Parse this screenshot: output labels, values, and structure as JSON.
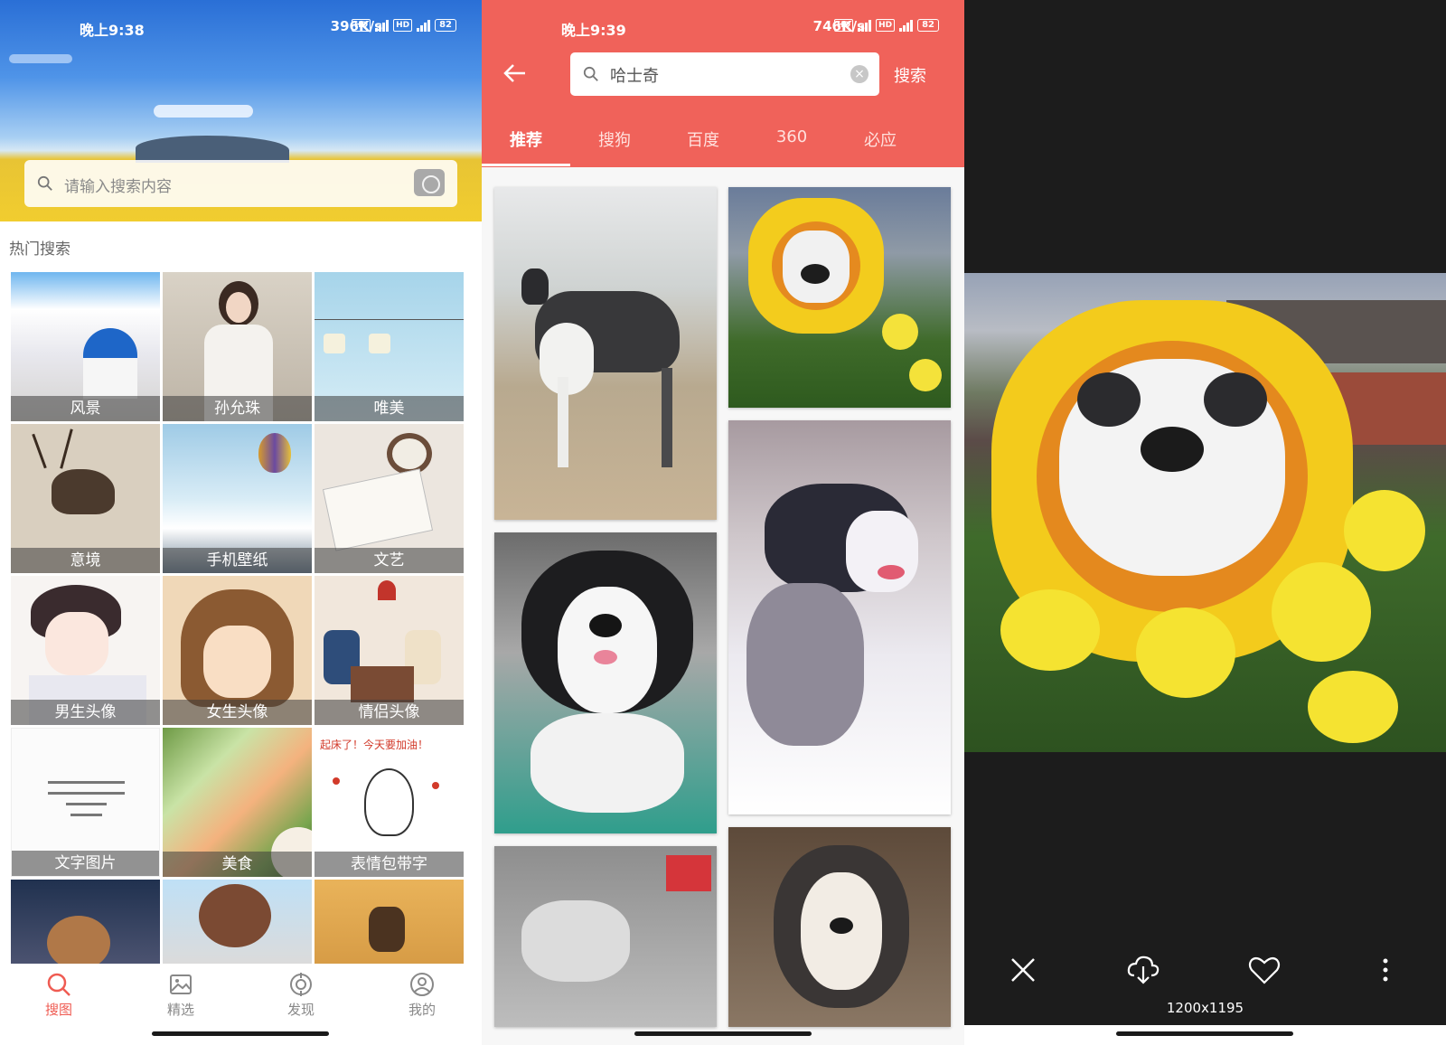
{
  "screen1": {
    "status": {
      "time": "晚上9:38",
      "net": "396K/s",
      "battery": "82"
    },
    "search": {
      "placeholder": "请输入搜索内容"
    },
    "hot_title": "热门搜索",
    "tiles": [
      {
        "label": "风景"
      },
      {
        "label": "孙允珠"
      },
      {
        "label": "唯美"
      },
      {
        "label": "意境"
      },
      {
        "label": "手机壁纸"
      },
      {
        "label": "文艺"
      },
      {
        "label": "男生头像"
      },
      {
        "label": "女生头像"
      },
      {
        "label": "情侣头像"
      },
      {
        "label": "文字图片"
      },
      {
        "label": "美食"
      },
      {
        "label": "表情包带字"
      }
    ],
    "sticker_text": "起床了！今天要加油！",
    "nav": [
      {
        "label": "搜图",
        "icon": "search-icon"
      },
      {
        "label": "精选",
        "icon": "image-icon"
      },
      {
        "label": "发现",
        "icon": "compass-icon"
      },
      {
        "label": "我的",
        "icon": "user-icon"
      }
    ]
  },
  "screen2": {
    "status": {
      "time": "晚上9:39",
      "net": "746K/s",
      "battery": "82"
    },
    "search_value": "哈士奇",
    "search_button": "搜索",
    "tabs": [
      {
        "label": "推荐"
      },
      {
        "label": "搜狗"
      },
      {
        "label": "百度"
      },
      {
        "label": "360"
      },
      {
        "label": "必应"
      }
    ],
    "active_tab": 0
  },
  "screen3": {
    "dimensions": "1200x1195",
    "actions": [
      "close-icon",
      "cloud-download-icon",
      "heart-icon",
      "more-vertical-icon"
    ]
  },
  "colors": {
    "accent": "#ef5b52",
    "header": "#f0625a",
    "viewer_bg": "#1c1c1c"
  }
}
